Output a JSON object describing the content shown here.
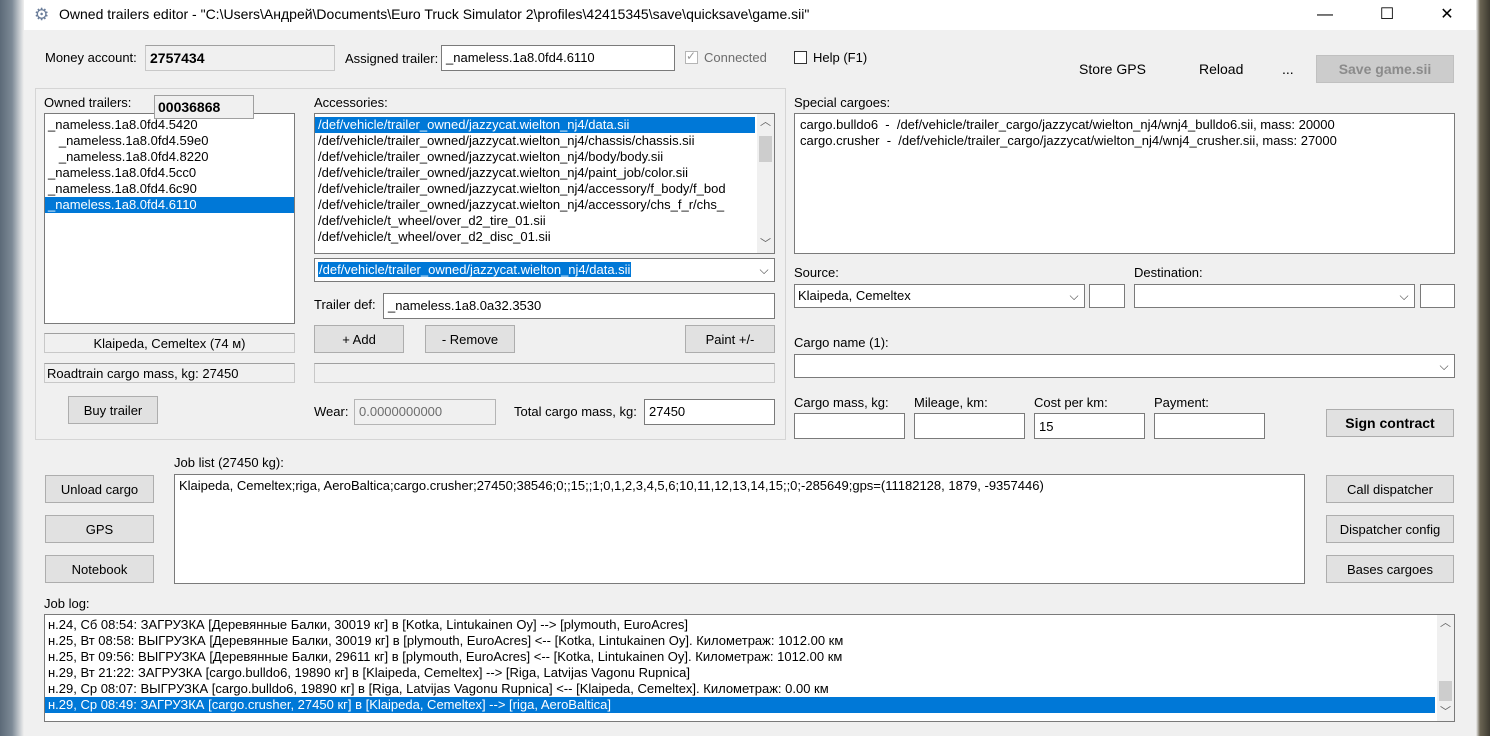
{
  "window": {
    "title": "Owned trailers editor - \"C:\\Users\\Андрей\\Documents\\Euro Truck Simulator 2\\profiles\\42415345\\save\\quicksave\\game.sii\"",
    "minimize": "—",
    "maximize": "☐",
    "close": "✕"
  },
  "header": {
    "money_label": "Money account:",
    "money_value": "2757434",
    "assigned_label": "Assigned trailer:",
    "assigned_value": "_nameless.1a8.0fd4.6110",
    "connected_label": "Connected",
    "connected_checked": true,
    "help_label": "Help (F1)",
    "store_gps": "Store GPS",
    "reload": "Reload",
    "more": "...",
    "save": "Save game.sii"
  },
  "owned": {
    "label": "Owned trailers:",
    "counter": "00036868",
    "items": [
      "_nameless.1a8.0fd4.5420",
      "   _nameless.1a8.0fd4.59e0",
      "   _nameless.1a8.0fd4.8220",
      "_nameless.1a8.0fd4.5cc0",
      "_nameless.1a8.0fd4.6c90",
      "_nameless.1a8.0fd4.6110"
    ],
    "location": "Klaipeda, Cemeltex (74 м)",
    "roadtrain_mass": "Roadtrain cargo mass, kg: 27450",
    "buy": "Buy trailer"
  },
  "accessories": {
    "label": "Accessories:",
    "items": [
      "/def/vehicle/trailer_owned/jazzycat.wielton_nj4/data.sii",
      "/def/vehicle/trailer_owned/jazzycat.wielton_nj4/chassis/chassis.sii",
      "/def/vehicle/trailer_owned/jazzycat.wielton_nj4/body/body.sii",
      "/def/vehicle/trailer_owned/jazzycat.wielton_nj4/paint_job/color.sii",
      "/def/vehicle/trailer_owned/jazzycat.wielton_nj4/accessory/f_body/f_bod",
      "/def/vehicle/trailer_owned/jazzycat.wielton_nj4/accessory/chs_f_r/chs_",
      "/def/vehicle/t_wheel/over_d2_tire_01.sii",
      "/def/vehicle/t_wheel/over_d2_disc_01.sii"
    ],
    "combo_value": "/def/vehicle/trailer_owned/jazzycat.wielton_nj4/data.sii",
    "trailer_def_label": "Trailer def:",
    "trailer_def_value": "_nameless.1a8.0a32.3530",
    "add": "+ Add",
    "remove": "- Remove",
    "paint": "Paint +/-",
    "wear_label": "Wear:",
    "wear_value": "0.0000000000",
    "total_mass_label": "Total cargo mass, kg:",
    "total_mass_value": "27450"
  },
  "special": {
    "label": "Special cargoes:",
    "items": [
      "cargo.bulldo6  -  /def/vehicle/trailer_cargo/jazzycat/wielton_nj4/wnj4_bulldo6.sii, mass: 20000",
      "cargo.crusher  -  /def/vehicle/trailer_cargo/jazzycat/wielton_nj4/wnj4_crusher.sii, mass: 27000"
    ],
    "source_label": "Source:",
    "source_value": "Klaipeda, Cemeltex",
    "destination_label": "Destination:",
    "destination_value": "",
    "cargo_name_label": "Cargo name (1):",
    "cargo_name_value": "",
    "cargo_mass_label": "Cargo mass, kg:",
    "mileage_label": "Mileage, km:",
    "cost_label": "Cost per km:",
    "cost_value": "15",
    "payment_label": "Payment:",
    "sign": "Sign contract"
  },
  "jobs": {
    "unload": "Unload cargo",
    "gps": "GPS",
    "notebook": "Notebook",
    "list_label": "Job list (27450 kg):",
    "list_text": "Klaipeda, Cemeltex;riga, AeroBaltica;cargo.crusher;27450;38546;0;;15;;1;0,1,2,3,4,5,6;10,11,12,13,14,15;;0;-285649;gps=(11182128, 1879, -9357446)",
    "call_dispatcher": "Call dispatcher",
    "dispatcher_config": "Dispatcher config",
    "bases_cargoes": "Bases cargoes"
  },
  "log": {
    "label": "Job log:",
    "items": [
      "н.24, Сб 08:54: ЗАГРУЗКА [Деревянные Балки, 30019 кг] в [Kotka, Lintukainen Oy] --> [plymouth, EuroAcres]",
      "н.25, Вт 08:58: ВЫГРУЗКА [Деревянные Балки, 30019 кг] в [plymouth, EuroAcres] <-- [Kotka, Lintukainen Oy]. Километраж: 1012.00 км",
      "н.25, Вт 09:56: ВЫГРУЗКА [Деревянные Балки, 29611 кг] в [plymouth, EuroAcres] <-- [Kotka, Lintukainen Oy]. Километраж: 1012.00 км",
      "н.29, Вт 21:22: ЗАГРУЗКА [cargo.bulldo6, 19890 кг] в [Klaipeda, Cemeltex] --> [Riga, Latvijas Vagonu Rupnica]",
      "н.29, Ср 08:07: ВЫГРУЗКА [cargo.bulldo6, 19890 кг] в [Riga, Latvijas Vagonu Rupnica] <-- [Klaipeda, Cemeltex]. Километраж: 0.00 км",
      "н.29, Ср 08:49: ЗАГРУЗКА [cargo.crusher, 27450 кг] в [Klaipeda, Cemeltex] --> [riga, AeroBaltica]"
    ]
  }
}
